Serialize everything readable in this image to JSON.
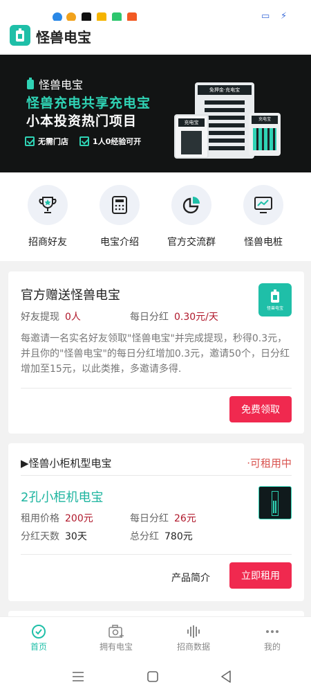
{
  "app": {
    "title": "怪兽电宝"
  },
  "banner": {
    "brand": "怪兽电宝",
    "headline": "怪兽充电共享充电宝",
    "subheadline": "小本投资热门项目",
    "tags": [
      "无需门店",
      "1人0经验可开"
    ],
    "cabinet_labels": [
      "充电宝",
      "免押金·充电宝",
      "充电宝"
    ]
  },
  "quicknav": [
    {
      "label": "招商好友",
      "icon": "trophy-icon"
    },
    {
      "label": "电宝介绍",
      "icon": "calculator-icon"
    },
    {
      "label": "官方交流群",
      "icon": "pie-chart-icon"
    },
    {
      "label": "怪兽电桩",
      "icon": "monitor-chart-icon"
    }
  ],
  "gift_card": {
    "title": "官方赠送怪兽电宝",
    "logo_text": "怪兽电宝",
    "withdraw_label": "好友提现",
    "withdraw_value": "0人",
    "daily_label": "每日分红",
    "daily_value": "0.30元/天",
    "description": "每邀请一名实名好友领取\"怪兽电宝\"并完成提现，秒得0.3元，并且你的\"怪兽电宝\"的每日分红增加0.3元，邀请50个，日分红增加至15元，以此类推，多邀请多得.",
    "button": "免费领取"
  },
  "product_card": {
    "section_title": "▶怪兽小柜机型电宝",
    "status": "·可租用中",
    "name": "2孔小柜机电宝",
    "price_label": "租用价格",
    "price_value": "200元",
    "daily_label": "每日分红",
    "daily_value": "26元",
    "days_label": "分红天数",
    "days_value": "30天",
    "total_label": "总分红",
    "total_value": "780元",
    "intro_link": "产品简介",
    "button": "立即租用"
  },
  "tabbar": [
    {
      "label": "首页",
      "icon": "home-check-icon",
      "active": true
    },
    {
      "label": "拥有电宝",
      "icon": "camera-add-icon",
      "active": false
    },
    {
      "label": "招商数据",
      "icon": "bars-icon",
      "active": false
    },
    {
      "label": "我的",
      "icon": "more-dots-icon",
      "active": false
    }
  ],
  "colors": {
    "accent": "#1fbfa8",
    "primary_button": "#f0294f",
    "highlight_value": "#b0182b",
    "banner_bg": "#121414"
  }
}
